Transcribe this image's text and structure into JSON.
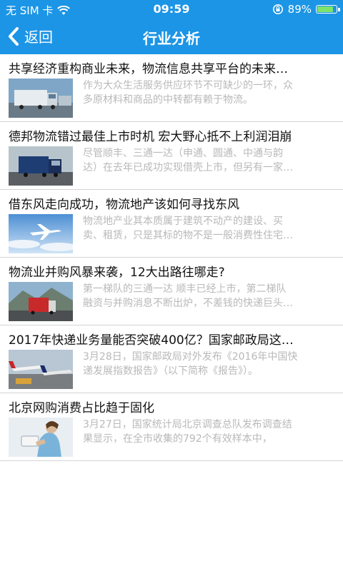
{
  "status": {
    "carrier": "无 SIM 卡",
    "time": "09:59",
    "battery": "89%",
    "battery_level": 0.89
  },
  "nav": {
    "back_label": "返回",
    "title": "行业分析"
  },
  "items": [
    {
      "title": "共享经济重构商业未来，物流信息共享平台的未来…",
      "summary_1": "作为大众生活服务供应环节不可缺少的一环，众",
      "summary_2": "多原材料和商品的中转都有赖于物流。"
    },
    {
      "title": "德邦物流错过最佳上市时机 宏大野心抵不上利润泪崩",
      "summary_1": "尽管顺丰、三通一达（申通、圆通、中通与韵",
      "summary_2": "达）在去年已成功实现借壳上市，但另有一家…"
    },
    {
      "title": "借东风走向成功，物流地产该如何寻找东风",
      "summary_1": "物流地产业其本质属于建筑不动产的建设、买",
      "summary_2": "卖、租赁，只是其标的物不是一般消费性住宅…"
    },
    {
      "title": "物流业并购风暴来袭，12大出路往哪走?",
      "summary_1": "第一梯队的三通一达 顺丰已经上市，第二梯队",
      "summary_2": "融资与并购消息不断出炉，不差钱的快递巨头…"
    },
    {
      "title": "2017年快递业务量能否突破400亿？国家邮政局这…",
      "summary_1": "3月28日，国家邮政局对外发布《2016年中国快",
      "summary_2": "递发展指数报告》（以下简称《报告》）。"
    },
    {
      "title": "北京网购消费占比趋于固化",
      "summary_1": "3月27日，国家统计局北京调查总队发布调查结",
      "summary_2": "果显示，在全市收集的792个有效样本中，"
    }
  ]
}
